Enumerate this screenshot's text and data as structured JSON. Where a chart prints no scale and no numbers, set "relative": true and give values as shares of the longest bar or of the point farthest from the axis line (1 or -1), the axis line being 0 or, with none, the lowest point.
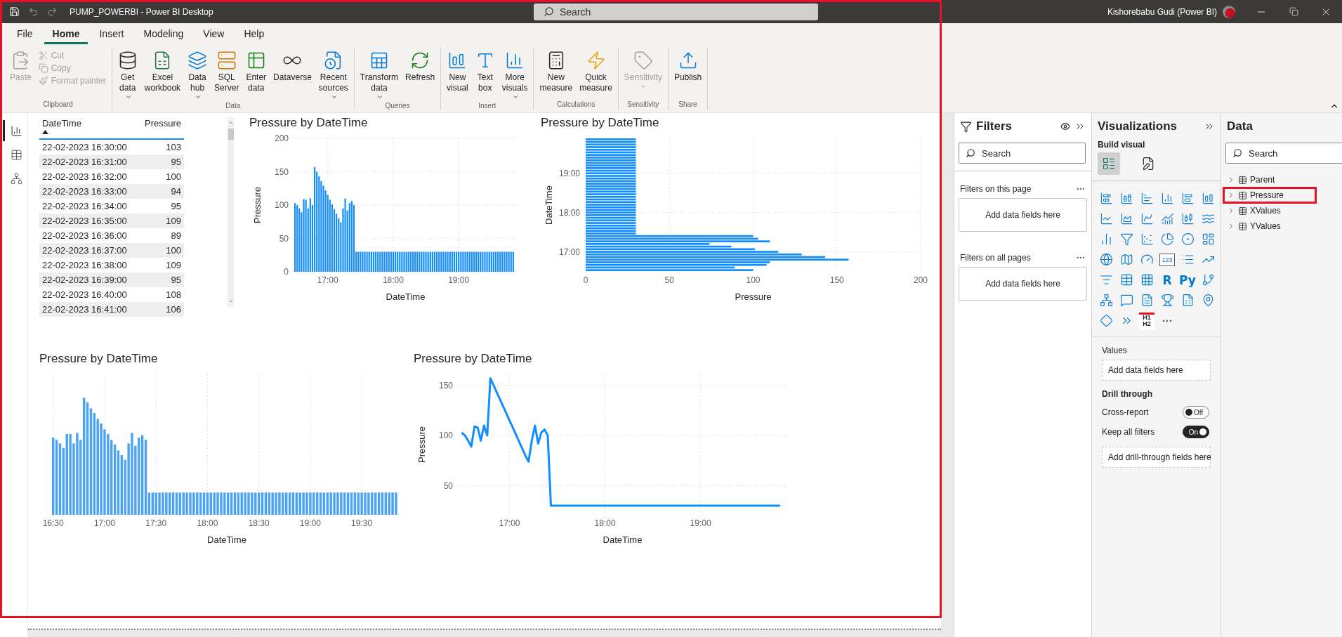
{
  "title_bar": {
    "title": "PUMP_POWERBI - Power BI Desktop",
    "search_placeholder": "Search",
    "user": "Kishorebabu Gudi (Power BI)",
    "undo_disabled": true,
    "redo_disabled": true
  },
  "menu_tabs": [
    {
      "label": "File",
      "selected": false
    },
    {
      "label": "Home",
      "selected": true
    },
    {
      "label": "Insert",
      "selected": false
    },
    {
      "label": "Modeling",
      "selected": false
    },
    {
      "label": "View",
      "selected": false
    },
    {
      "label": "Help",
      "selected": false
    }
  ],
  "ribbon_groups": [
    {
      "label": "Clipboard",
      "items": [
        {
          "kind": "large",
          "lines": [
            "Paste"
          ],
          "dropdown": false,
          "disabled": true
        },
        {
          "kind": "small",
          "lines": [
            "Cut"
          ],
          "disabled": true
        },
        {
          "kind": "small",
          "lines": [
            "Copy"
          ],
          "disabled": true
        },
        {
          "kind": "small",
          "lines": [
            "Format painter"
          ],
          "disabled": true
        }
      ]
    },
    {
      "label": "Data",
      "items": [
        {
          "kind": "large",
          "lines": [
            "Get",
            "data"
          ],
          "dropdown": true,
          "disabled": false
        },
        {
          "kind": "large",
          "lines": [
            "Excel",
            "workbook"
          ],
          "dropdown": false,
          "disabled": false
        },
        {
          "kind": "large",
          "lines": [
            "Data",
            "hub"
          ],
          "dropdown": true,
          "disabled": false
        },
        {
          "kind": "large",
          "lines": [
            "SQL",
            "Server"
          ],
          "dropdown": false,
          "disabled": false
        },
        {
          "kind": "large",
          "lines": [
            "Enter",
            "data"
          ],
          "dropdown": false,
          "disabled": false
        },
        {
          "kind": "large",
          "lines": [
            "Dataverse"
          ],
          "dropdown": false,
          "disabled": false
        },
        {
          "kind": "large",
          "lines": [
            "Recent",
            "sources"
          ],
          "dropdown": true,
          "disabled": false
        }
      ]
    },
    {
      "label": "Queries",
      "items": [
        {
          "kind": "large",
          "lines": [
            "Transform",
            "data"
          ],
          "dropdown": true,
          "disabled": false
        },
        {
          "kind": "large",
          "lines": [
            "Refresh"
          ],
          "dropdown": false,
          "disabled": false
        }
      ]
    },
    {
      "label": "Insert",
      "items": [
        {
          "kind": "large",
          "lines": [
            "New",
            "visual"
          ],
          "dropdown": false,
          "disabled": false
        },
        {
          "kind": "large",
          "lines": [
            "Text",
            "box"
          ],
          "dropdown": false,
          "disabled": false
        },
        {
          "kind": "large",
          "lines": [
            "More",
            "visuals"
          ],
          "dropdown": true,
          "disabled": false
        }
      ]
    },
    {
      "label": "Calculations",
      "items": [
        {
          "kind": "large",
          "lines": [
            "New",
            "measure"
          ],
          "dropdown": false,
          "disabled": false
        },
        {
          "kind": "large",
          "lines": [
            "Quick",
            "measure"
          ],
          "dropdown": false,
          "disabled": false
        }
      ]
    },
    {
      "label": "Sensitivity",
      "items": [
        {
          "kind": "large",
          "lines": [
            "Sensitivity"
          ],
          "dropdown": true,
          "disabled": true
        }
      ]
    },
    {
      "label": "Share",
      "items": [
        {
          "kind": "large",
          "lines": [
            "Publish"
          ],
          "dropdown": false,
          "disabled": false
        }
      ]
    }
  ],
  "view_switcher": [
    {
      "selected": true
    },
    {
      "selected": false
    },
    {
      "selected": false
    }
  ],
  "visual_rows": [
    [
      {
        "kind": "table",
        "columns": [
          {
            "label": "DateTime",
            "sorted": true
          },
          {
            "label": "Pressure",
            "sorted": false
          }
        ],
        "rows": [
          [
            "22-02-2023 16:30:00",
            "103"
          ],
          [
            "22-02-2023 16:31:00",
            "95"
          ],
          [
            "22-02-2023 16:32:00",
            "100"
          ],
          [
            "22-02-2023 16:33:00",
            "94"
          ],
          [
            "22-02-2023 16:34:00",
            "95"
          ],
          [
            "22-02-2023 16:35:00",
            "109"
          ],
          [
            "22-02-2023 16:36:00",
            "89"
          ],
          [
            "22-02-2023 16:37:00",
            "100"
          ],
          [
            "22-02-2023 16:38:00",
            "109"
          ],
          [
            "22-02-2023 16:39:00",
            "95"
          ],
          [
            "22-02-2023 16:40:00",
            "108"
          ],
          [
            "22-02-2023 16:41:00",
            "106"
          ]
        ]
      },
      {
        "kind": "chart",
        "title": "Pressure by DateTime",
        "chart_data": {
          "type": "bar",
          "xlabel": "DateTime",
          "ylabel": "Pressure",
          "grid": true,
          "categories": [
            null,
            null,
            null,
            null,
            null,
            null,
            null,
            null,
            null,
            null,
            null,
            null,
            null,
            null,
            null,
            "17:00",
            null,
            null,
            null,
            null,
            null,
            null,
            null,
            null,
            null,
            null,
            null,
            null,
            null,
            null,
            null,
            null,
            null,
            null,
            null,
            null,
            null,
            null,
            null,
            null,
            null,
            null,
            null,
            null,
            null,
            "18:00",
            null,
            null,
            null,
            null,
            null,
            null,
            null,
            null,
            null,
            null,
            null,
            null,
            null,
            null,
            null,
            null,
            null,
            null,
            null,
            null,
            null,
            null,
            null,
            null,
            null,
            null,
            null,
            null,
            null,
            "19:00",
            null,
            null,
            null,
            null,
            null,
            null,
            null,
            null,
            null,
            null,
            null,
            null,
            null,
            null,
            null,
            null,
            null,
            null,
            null,
            null,
            null,
            null,
            null,
            null,
            null
          ],
          "series": [
            {
              "color": "#118dff",
              "values": [
                103,
                100,
                95,
                89,
                109,
                108,
                95,
                110,
                100,
                157,
                150,
                143,
                136,
                129,
                122,
                115,
                108,
                101,
                94,
                87,
                80,
                74,
                95,
                110,
                92,
                103,
                106,
                100,
                30,
                30,
                30,
                30,
                30,
                30,
                30,
                30,
                30,
                30,
                30,
                30,
                30,
                30,
                30,
                30,
                30,
                30,
                30,
                30,
                30,
                30,
                30,
                30,
                30,
                30,
                30,
                30,
                30,
                30,
                30,
                30,
                30,
                30,
                30,
                30,
                30,
                30,
                30,
                30,
                30,
                30,
                30,
                30,
                30,
                30,
                30,
                30,
                30,
                30,
                30,
                30,
                30,
                30,
                30,
                30,
                30,
                30,
                30,
                30,
                30,
                30,
                30,
                30,
                30,
                30,
                30,
                30,
                30,
                30,
                30,
                30,
                30
              ]
            }
          ],
          "ylim": [
            0,
            200
          ],
          "yticks": [
            0,
            50,
            100,
            150,
            200
          ]
        }
      },
      {
        "kind": "chart",
        "title": "Pressure by DateTime",
        "chart_data": {
          "type": "bar",
          "orientation": "horizontal",
          "xlabel": "Pressure",
          "ylabel": "DateTime",
          "grid": true,
          "categories": [
            null,
            null,
            null,
            null,
            null,
            null,
            null,
            null,
            null,
            null,
            null,
            null,
            null,
            "19:00",
            null,
            null,
            null,
            null,
            null,
            null,
            null,
            null,
            null,
            null,
            null,
            null,
            null,
            null,
            "18:00",
            null,
            null,
            null,
            null,
            null,
            null,
            null,
            null,
            null,
            null,
            null,
            null,
            null,
            null,
            "17:00",
            null,
            null,
            null,
            null,
            null,
            null,
            null
          ],
          "series": [
            {
              "color": "#118dff",
              "values": [
                30,
                30,
                30,
                30,
                30,
                30,
                30,
                30,
                30,
                30,
                30,
                30,
                30,
                30,
                30,
                30,
                30,
                30,
                30,
                30,
                30,
                30,
                30,
                30,
                30,
                30,
                30,
                30,
                30,
                30,
                30,
                30,
                30,
                30,
                30,
                30,
                30,
                100,
                103,
                110,
                74,
                87,
                101,
                115,
                129,
                143,
                157,
                110,
                108,
                89,
                100
              ]
            }
          ],
          "xlim": [
            0,
            200
          ],
          "xticks": [
            0,
            50,
            100,
            150,
            200
          ]
        }
      }
    ],
    [
      {
        "kind": "chart",
        "title": "Pressure by DateTime",
        "chart_data": {
          "type": "bar",
          "xlabel": "DateTime",
          "grid": true,
          "relative": true,
          "categories": [
            "16:30",
            null,
            null,
            null,
            null,
            null,
            null,
            null,
            null,
            null,
            null,
            null,
            null,
            null,
            null,
            "17:00",
            null,
            null,
            null,
            null,
            null,
            null,
            null,
            null,
            null,
            null,
            null,
            null,
            null,
            null,
            "17:30",
            null,
            null,
            null,
            null,
            null,
            null,
            null,
            null,
            null,
            null,
            null,
            null,
            null,
            null,
            "18:00",
            null,
            null,
            null,
            null,
            null,
            null,
            null,
            null,
            null,
            null,
            null,
            null,
            null,
            null,
            "18:30",
            null,
            null,
            null,
            null,
            null,
            null,
            null,
            null,
            null,
            null,
            null,
            null,
            null,
            null,
            "19:00",
            null,
            null,
            null,
            null,
            null,
            null,
            null,
            null,
            null,
            null,
            null,
            null,
            null,
            null,
            "19:30",
            null,
            null,
            null,
            null,
            null,
            null,
            null,
            null,
            null,
            null
          ],
          "series": [
            {
              "color": "#4aa3f5",
              "values": [
                0.66,
                0.64,
                0.61,
                0.57,
                0.69,
                0.69,
                0.61,
                0.7,
                0.64,
                1,
                0.96,
                0.91,
                0.87,
                0.82,
                0.78,
                0.73,
                0.69,
                0.64,
                0.6,
                0.55,
                0.51,
                0.47,
                0.61,
                0.7,
                0.59,
                0.66,
                0.68,
                0.64,
                0.19,
                0.19,
                0.19,
                0.19,
                0.19,
                0.19,
                0.19,
                0.19,
                0.19,
                0.19,
                0.19,
                0.19,
                0.19,
                0.19,
                0.19,
                0.19,
                0.19,
                0.19,
                0.19,
                0.19,
                0.19,
                0.19,
                0.19,
                0.19,
                0.19,
                0.19,
                0.19,
                0.19,
                0.19,
                0.19,
                0.19,
                0.19,
                0.19,
                0.19,
                0.19,
                0.19,
                0.19,
                0.19,
                0.19,
                0.19,
                0.19,
                0.19,
                0.19,
                0.19,
                0.19,
                0.19,
                0.19,
                0.19,
                0.19,
                0.19,
                0.19,
                0.19,
                0.19,
                0.19,
                0.19,
                0.19,
                0.19,
                0.19,
                0.19,
                0.19,
                0.19,
                0.19,
                0.19,
                0.19,
                0.19,
                0.19,
                0.19,
                0.19,
                0.19,
                0.19,
                0.19,
                0.19,
                0.19
              ]
            }
          ]
        }
      },
      {
        "kind": "chart",
        "title": "Pressure by DateTime",
        "chart_data": {
          "type": "line",
          "xlabel": "DateTime",
          "ylabel": "Pressure",
          "grid": true,
          "categories": [
            null,
            null,
            null,
            null,
            null,
            null,
            null,
            null,
            null,
            null,
            null,
            null,
            null,
            null,
            null,
            "17:00",
            null,
            null,
            null,
            null,
            null,
            null,
            null,
            null,
            null,
            null,
            null,
            null,
            null,
            null,
            null,
            null,
            null,
            null,
            null,
            null,
            null,
            null,
            null,
            null,
            null,
            null,
            null,
            null,
            null,
            "18:00",
            null,
            null,
            null,
            null,
            null,
            null,
            null,
            null,
            null,
            null,
            null,
            null,
            null,
            null,
            null,
            null,
            null,
            null,
            null,
            null,
            null,
            null,
            null,
            null,
            null,
            null,
            null,
            null,
            null,
            "19:00",
            null,
            null,
            null,
            null,
            null,
            null,
            null,
            null,
            null,
            null,
            null,
            null,
            null,
            null,
            null,
            null,
            null,
            null,
            null,
            null,
            null,
            null,
            null,
            null,
            null
          ],
          "series": [
            {
              "color": "#118dff",
              "values": [
                103,
                100,
                95,
                89,
                109,
                108,
                95,
                110,
                100,
                157,
                150,
                143,
                136,
                129,
                122,
                115,
                108,
                101,
                94,
                87,
                80,
                74,
                95,
                110,
                92,
                103,
                106,
                100,
                30,
                30,
                30,
                30,
                30,
                30,
                30,
                30,
                30,
                30,
                30,
                30,
                30,
                30,
                30,
                30,
                30,
                30,
                30,
                30,
                30,
                30,
                30,
                30,
                30,
                30,
                30,
                30,
                30,
                30,
                30,
                30,
                30,
                30,
                30,
                30,
                30,
                30,
                30,
                30,
                30,
                30,
                30,
                30,
                30,
                30,
                30,
                30,
                30,
                30,
                30,
                30,
                30,
                30,
                30,
                30,
                30,
                30,
                30,
                30,
                30,
                30,
                30,
                30,
                30,
                30,
                30,
                30,
                30,
                30,
                30,
                30,
                30
              ]
            }
          ],
          "ylim": [
            21,
            161
          ],
          "yticks": [
            50,
            100,
            150
          ]
        }
      }
    ]
  ],
  "filters_pane": {
    "title": "Filters",
    "search_placeholder": "Search",
    "sections": [
      {
        "label": "Filters on this page",
        "well": "Add data fields here"
      },
      {
        "label": "Filters on all pages",
        "well": "Add data fields here"
      }
    ]
  },
  "visualizations_pane": {
    "title": "Visualizations",
    "build_label": "Build visual",
    "build_tabs": [
      {
        "selected": true
      },
      {
        "selected": false
      }
    ],
    "gallery": [
      {
        "kind": "icon"
      },
      {
        "kind": "icon"
      },
      {
        "kind": "icon"
      },
      {
        "kind": "icon"
      },
      {
        "kind": "icon"
      },
      {
        "kind": "icon"
      },
      {
        "kind": "icon"
      },
      {
        "kind": "icon"
      },
      {
        "kind": "icon"
      },
      {
        "kind": "icon"
      },
      {
        "kind": "icon"
      },
      {
        "kind": "icon"
      },
      {
        "kind": "icon"
      },
      {
        "kind": "icon"
      },
      {
        "kind": "icon"
      },
      {
        "kind": "icon"
      },
      {
        "kind": "icon"
      },
      {
        "kind": "icon"
      },
      {
        "kind": "icon"
      },
      {
        "kind": "icon"
      },
      {
        "kind": "icon"
      },
      {
        "kind": "card",
        "text": "123"
      },
      {
        "kind": "icon"
      },
      {
        "kind": "icon"
      },
      {
        "kind": "icon"
      },
      {
        "kind": "icon"
      },
      {
        "kind": "icon"
      },
      {
        "kind": "glyph",
        "text": "R"
      },
      {
        "kind": "glyph",
        "text": "Py"
      },
      {
        "kind": "icon"
      },
      {
        "kind": "icon"
      },
      {
        "kind": "icon"
      },
      {
        "kind": "icon"
      },
      {
        "kind": "icon"
      },
      {
        "kind": "icon"
      },
      {
        "kind": "icon"
      },
      {
        "kind": "icon"
      },
      {
        "kind": "icon"
      },
      {
        "kind": "heading",
        "lines": [
          "H1",
          "H2"
        ]
      },
      {
        "kind": "more",
        "text": "···"
      }
    ],
    "values_label": "Values",
    "values_well": "Add data fields here",
    "drill_label": "Drill through",
    "toggles": [
      {
        "label": "Cross-report",
        "on": false,
        "state_label": "Off"
      },
      {
        "label": "Keep all filters",
        "on": true,
        "state_label": "On"
      }
    ],
    "drill_well": "Add drill-through fields here"
  },
  "data_pane": {
    "title": "Data",
    "search_placeholder": "Search",
    "tables": [
      {
        "name": "Parent",
        "expanded": false,
        "highlighted": false
      },
      {
        "name": "Pressure",
        "expanded": false,
        "highlighted": true
      },
      {
        "name": "XValues",
        "expanded": false,
        "highlighted": false
      },
      {
        "name": "YValues",
        "expanded": false,
        "highlighted": false
      }
    ]
  },
  "annotation": {
    "frame": true
  }
}
